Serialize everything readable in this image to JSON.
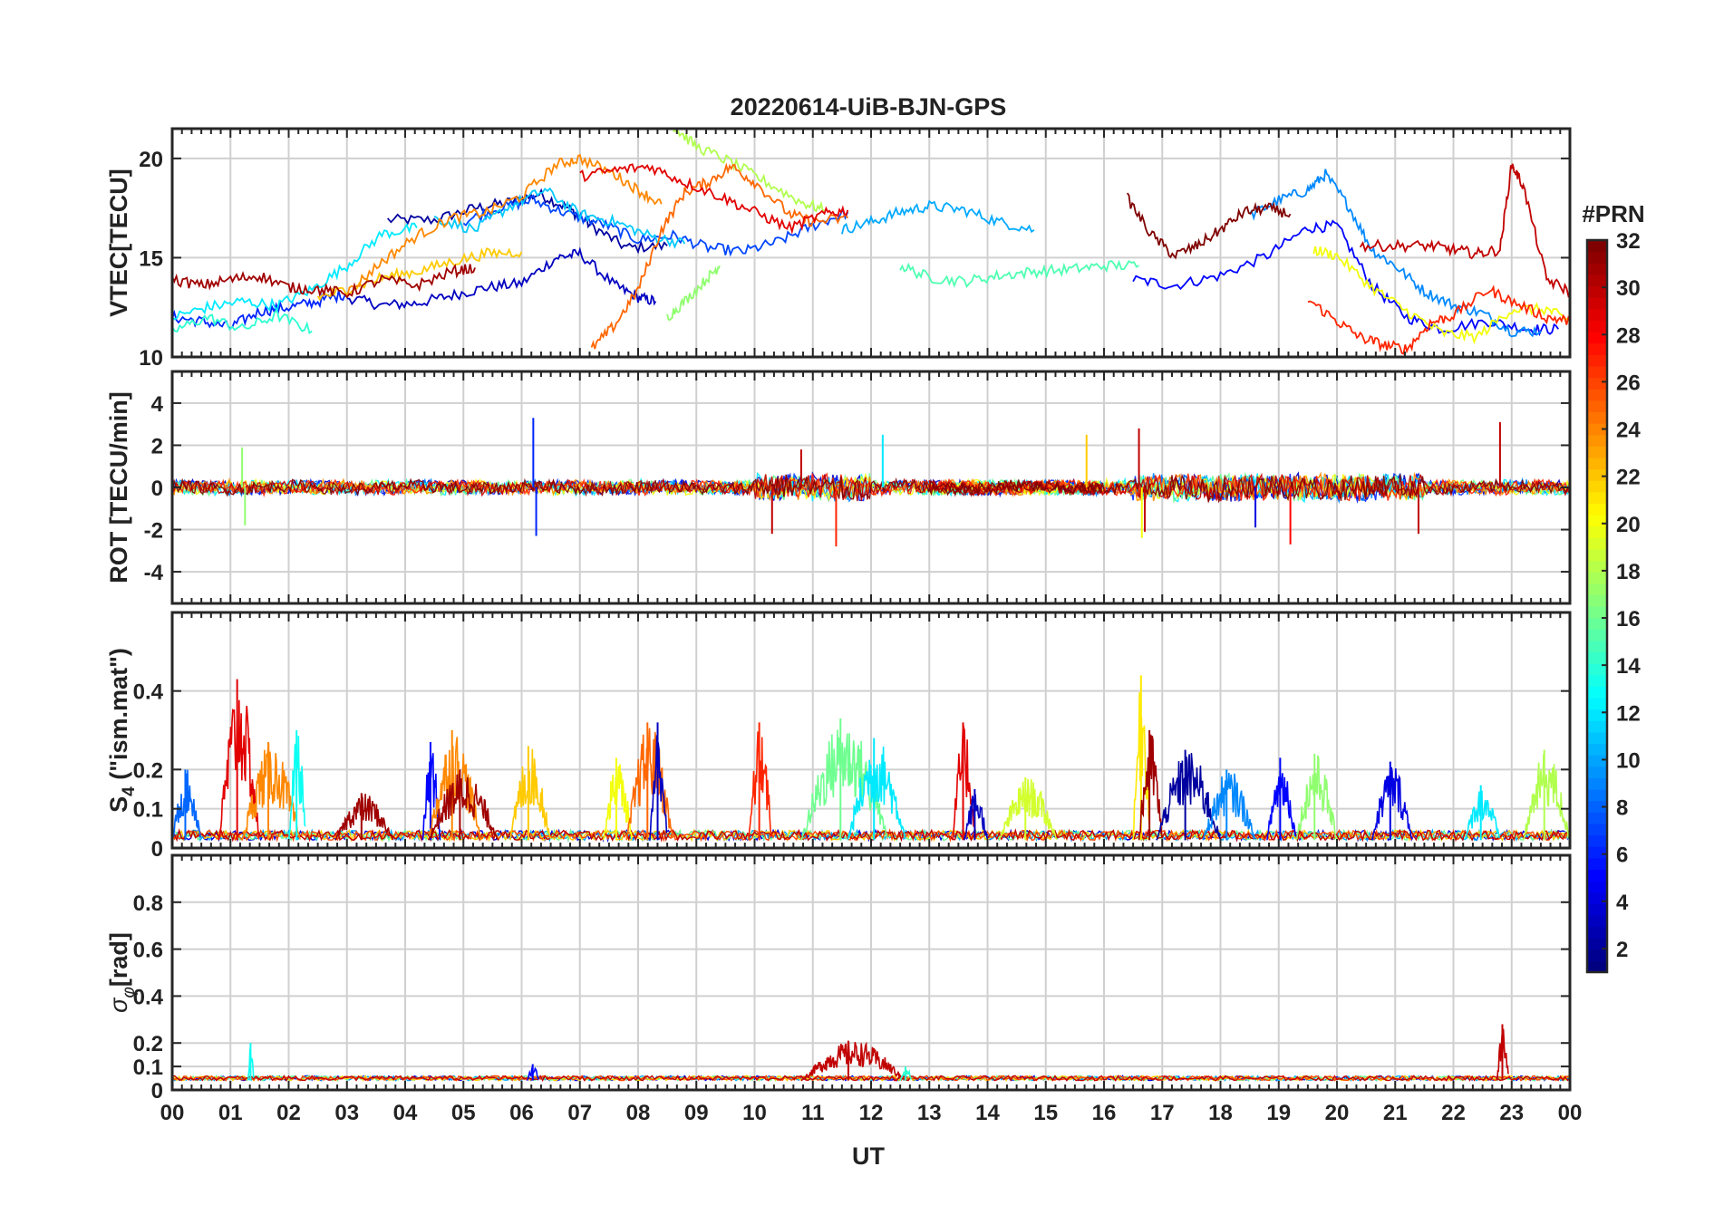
{
  "chart_data": {
    "type": "line",
    "title": "20220614-UiB-BJN-GPS",
    "xlabel": "UT",
    "x_range_hours": [
      0,
      24
    ],
    "x_tick_labels": [
      "00",
      "01",
      "02",
      "03",
      "04",
      "05",
      "06",
      "07",
      "08",
      "09",
      "10",
      "11",
      "12",
      "13",
      "14",
      "15",
      "16",
      "17",
      "18",
      "19",
      "20",
      "21",
      "22",
      "23",
      "00"
    ],
    "grid": true,
    "colormap": "jet",
    "colorbar": {
      "label": "#PRN",
      "range": [
        1,
        32
      ],
      "tick_values": [
        2,
        4,
        6,
        8,
        10,
        12,
        14,
        16,
        18,
        20,
        22,
        24,
        26,
        28,
        30,
        32
      ],
      "tick_labels": [
        "2",
        "4",
        "6",
        "8",
        "10",
        "12",
        "14",
        "16",
        "18",
        "20",
        "22",
        "24",
        "26",
        "28",
        "30",
        "32"
      ],
      "placement": "right"
    },
    "panels": [
      {
        "id": "vtec",
        "ylabel": "VTEC[TECU]",
        "ylim": [
          10,
          21.5
        ],
        "yticks": [
          10,
          15,
          20
        ],
        "ytick_labels": [
          "10",
          "15",
          "20"
        ],
        "series": [
          {
            "prn": 2,
            "x": [
              3.7,
              4.5,
              5.2,
              5.8,
              6.3,
              6.8,
              7.2,
              7.8,
              8.5
            ],
            "y": [
              16.9,
              16.9,
              17.5,
              17.8,
              18.2,
              17.5,
              16.6,
              15.5,
              15.6
            ]
          },
          {
            "prn": 3,
            "x": [
              3.0,
              3.6,
              4.2,
              4.8,
              5.4,
              6.0,
              6.6,
              7.0,
              7.6,
              8.0,
              8.3
            ],
            "y": [
              13.0,
              12.6,
              12.7,
              13.1,
              13.5,
              13.7,
              15.0,
              15.2,
              13.6,
              13.0,
              12.8
            ]
          },
          {
            "prn": 5,
            "x": [
              16.5,
              17.2,
              18.0,
              18.8,
              19.5,
              20.0,
              20.6,
              21.2,
              21.8,
              22.6,
              23.3,
              23.8
            ],
            "y": [
              13.9,
              13.6,
              14.1,
              15.1,
              16.5,
              16.6,
              13.6,
              12.0,
              11.4,
              11.8,
              11.4,
              11.4
            ]
          },
          {
            "prn": 6,
            "x": [
              0,
              0.5,
              1.0,
              1.5,
              2.0,
              2.5,
              3.0
            ],
            "y": [
              12.0,
              11.8,
              11.5,
              12.3,
              12.5,
              12.8,
              13.2
            ]
          },
          {
            "prn": 7,
            "x": [
              5.0,
              5.6,
              6.2,
              6.8,
              7.4,
              8.0,
              8.6,
              9.2,
              9.8,
              10.4,
              11.0,
              11.6
            ],
            "y": [
              16.8,
              17.5,
              17.9,
              17.2,
              16.7,
              15.9,
              16.1,
              15.5,
              15.3,
              15.8,
              16.6,
              17.3
            ]
          },
          {
            "prn": 9,
            "x": [
              18.5,
              19.0,
              19.5,
              19.8,
              20.2,
              20.6,
              21.0,
              21.5,
              22.0,
              22.5,
              23.0,
              23.5
            ],
            "y": [
              17.1,
              17.9,
              18.4,
              19.2,
              17.6,
              15.4,
              14.6,
              13.3,
              12.6,
              12.2,
              11.3,
              11.3
            ]
          },
          {
            "prn": 10,
            "x": [
              11.5,
              12.0,
              12.5,
              13.0,
              13.6,
              14.2,
              14.8
            ],
            "y": [
              16.4,
              16.8,
              17.3,
              17.6,
              17.4,
              16.8,
              16.4
            ]
          },
          {
            "prn": 11,
            "x": [
              4.5,
              5.2,
              5.8,
              6.4,
              7.0,
              7.6,
              8.2,
              8.8
            ],
            "y": [
              17.0,
              16.4,
              17.6,
              18.4,
              17.2,
              16.8,
              16.1,
              15.7
            ]
          },
          {
            "prn": 12,
            "x": [
              0,
              0.6,
              1.2,
              1.8,
              2.4,
              3.0,
              3.6,
              4.2
            ],
            "y": [
              12.0,
              12.5,
              12.8,
              12.6,
              13.4,
              14.6,
              16.2,
              16.5
            ]
          },
          {
            "prn": 14,
            "x": [
              0,
              0.6,
              1.2,
              1.8,
              2.4
            ],
            "y": [
              11.3,
              12.0,
              11.4,
              12.1,
              11.3
            ]
          },
          {
            "prn": 15,
            "x": [
              12.5,
              13.0,
              13.6,
              14.2,
              14.8,
              15.4,
              16.0,
              16.6
            ],
            "y": [
              14.6,
              14.0,
              13.8,
              14.1,
              14.3,
              14.4,
              14.6,
              14.6
            ]
          },
          {
            "prn": 17,
            "x": [
              8.5,
              8.8,
              9.2,
              9.4
            ],
            "y": [
              12.0,
              12.8,
              14.0,
              14.6
            ]
          },
          {
            "prn": 18,
            "x": [
              8.6,
              9.0,
              9.6,
              10.2,
              10.8,
              11.2
            ],
            "y": [
              21.6,
              20.6,
              19.8,
              18.8,
              17.8,
              17.4
            ]
          },
          {
            "prn": 20,
            "x": [
              19.6,
              20.0,
              20.6,
              21.2,
              21.8,
              22.4,
              23.0,
              23.6,
              24.0
            ],
            "y": [
              15.4,
              15.1,
              13.5,
              12.3,
              11.2,
              11.0,
              12.4,
              12.4,
              11.8
            ]
          },
          {
            "prn": 22,
            "x": [
              2.5,
              3.0,
              3.6,
              4.2,
              4.8,
              5.4,
              6.0
            ],
            "y": [
              13.0,
              13.4,
              14.0,
              14.3,
              14.8,
              15.2,
              15.3
            ]
          },
          {
            "prn": 24,
            "x": [
              3.0,
              3.6,
              4.2,
              4.8,
              5.4,
              6.0,
              6.6,
              7.0,
              7.6,
              8.0,
              8.4
            ],
            "y": [
              13.2,
              14.8,
              16.1,
              17.0,
              17.3,
              18.1,
              19.7,
              20.0,
              19.2,
              18.4,
              17.7
            ]
          },
          {
            "prn": 25,
            "x": [
              7.2,
              7.6,
              8.0,
              8.4,
              8.8,
              9.2,
              9.6,
              10.0,
              10.6,
              11.0,
              11.6
            ],
            "y": [
              10.4,
              11.6,
              13.4,
              16.4,
              18.3,
              18.8,
              19.6,
              18.8,
              17.2,
              16.8,
              17.0
            ]
          },
          {
            "prn": 27,
            "x": [
              19.5,
              20.0,
              20.4,
              20.8,
              21.2,
              21.6,
              22.0,
              22.6,
              23.0,
              23.6,
              24.0
            ],
            "y": [
              12.9,
              11.8,
              11.0,
              10.6,
              10.4,
              11.7,
              12.1,
              13.4,
              12.8,
              12.0,
              11.8
            ]
          },
          {
            "prn": 29,
            "x": [
              7.0,
              7.6,
              8.2,
              8.8,
              9.4,
              10.0,
              10.6,
              11.2,
              11.6
            ],
            "y": [
              19.1,
              19.4,
              19.6,
              18.8,
              18.1,
              17.3,
              16.5,
              17.2,
              17.4
            ]
          },
          {
            "prn": 30,
            "x": [
              20.4,
              21.0,
              21.6,
              22.0,
              22.4,
              22.8,
              23.0,
              23.2,
              23.6,
              24.0
            ],
            "y": [
              15.6,
              15.6,
              15.6,
              15.4,
              15.2,
              15.4,
              19.7,
              18.6,
              13.9,
              13.3
            ]
          },
          {
            "prn": 31,
            "x": [
              0,
              0.5,
              1.0,
              1.5,
              2.0,
              2.5,
              3.0,
              3.6,
              4.2,
              4.8,
              5.2
            ],
            "y": [
              13.9,
              13.6,
              13.9,
              14.1,
              13.5,
              13.4,
              13.2,
              13.9,
              13.6,
              14.3,
              14.5
            ]
          },
          {
            "prn": 32,
            "x": [
              16.4,
              16.8,
              17.2,
              17.6,
              18.0,
              18.4,
              18.8,
              19.2
            ],
            "y": [
              18.0,
              16.2,
              15.1,
              15.6,
              16.4,
              17.3,
              17.5,
              17.2
            ]
          }
        ]
      },
      {
        "id": "rot",
        "ylabel": "ROT [TECU/min]",
        "ylim": [
          -5.5,
          5.5
        ],
        "yticks": [
          -4,
          -2,
          0,
          2,
          4
        ],
        "ytick_labels": [
          "-4",
          "-2",
          "0",
          "2",
          "4"
        ],
        "noise_band": 0.25,
        "events": [
          {
            "prn": 6,
            "x": 6.2,
            "y": 3.3
          },
          {
            "prn": 6,
            "x": 6.25,
            "y": -2.3
          },
          {
            "prn": 27,
            "x": 11.4,
            "y": -2.8
          },
          {
            "prn": 30,
            "x": 10.8,
            "y": 1.8
          },
          {
            "prn": 30,
            "x": 10.3,
            "y": -2.2
          },
          {
            "prn": 12,
            "x": 12.2,
            "y": 2.5
          },
          {
            "prn": 22,
            "x": 15.7,
            "y": 2.5
          },
          {
            "prn": 30,
            "x": 16.6,
            "y": 2.8
          },
          {
            "prn": 30,
            "x": 16.7,
            "y": -2.1
          },
          {
            "prn": 20,
            "x": 16.65,
            "y": -2.4
          },
          {
            "prn": 28,
            "x": 19.2,
            "y": -2.7
          },
          {
            "prn": 30,
            "x": 21.4,
            "y": -2.2
          },
          {
            "prn": 30,
            "x": 22.8,
            "y": 3.1
          },
          {
            "prn": 17,
            "x": 1.2,
            "y": 1.9
          },
          {
            "prn": 17,
            "x": 1.25,
            "y": -1.8
          },
          {
            "prn": 4,
            "x": 18.6,
            "y": -1.9
          }
        ]
      },
      {
        "id": "s4",
        "ylabel": "S4 (\"ism.mat\")",
        "ylabel_main": "S",
        "ylabel_sub": "4",
        "ylabel_rest": " (\"ism.mat\")",
        "ylim": [
          0,
          0.6
        ],
        "yticks": [
          0,
          0.1,
          0.2,
          0.4
        ],
        "ytick_labels": [
          "0",
          "0.1",
          "0.2",
          "0.4"
        ],
        "bursts": [
          {
            "prn": 8,
            "x0": 0.0,
            "x1": 0.5,
            "peak": 0.2
          },
          {
            "prn": 29,
            "x0": 0.8,
            "x1": 1.5,
            "peak": 0.43
          },
          {
            "prn": 24,
            "x0": 1.2,
            "x1": 2.2,
            "peak": 0.27
          },
          {
            "prn": 13,
            "x0": 2.0,
            "x1": 2.3,
            "peak": 0.3
          },
          {
            "prn": 31,
            "x0": 2.8,
            "x1": 3.8,
            "peak": 0.14
          },
          {
            "prn": 5,
            "x0": 4.3,
            "x1": 4.6,
            "peak": 0.27
          },
          {
            "prn": 24,
            "x0": 4.4,
            "x1": 5.3,
            "peak": 0.3
          },
          {
            "prn": 31,
            "x0": 4.4,
            "x1": 5.6,
            "peak": 0.2
          },
          {
            "prn": 22,
            "x0": 5.8,
            "x1": 6.5,
            "peak": 0.26
          },
          {
            "prn": 20,
            "x0": 7.4,
            "x1": 7.9,
            "peak": 0.23
          },
          {
            "prn": 25,
            "x0": 7.8,
            "x1": 8.6,
            "peak": 0.32
          },
          {
            "prn": 3,
            "x0": 8.2,
            "x1": 8.5,
            "peak": 0.32
          },
          {
            "prn": 27,
            "x0": 9.9,
            "x1": 10.3,
            "peak": 0.32
          },
          {
            "prn": 16,
            "x0": 10.8,
            "x1": 12.3,
            "peak": 0.33
          },
          {
            "prn": 12,
            "x0": 11.6,
            "x1": 12.6,
            "peak": 0.28
          },
          {
            "prn": 29,
            "x0": 13.4,
            "x1": 13.8,
            "peak": 0.32
          },
          {
            "prn": 3,
            "x0": 13.6,
            "x1": 14.0,
            "peak": 0.15
          },
          {
            "prn": 19,
            "x0": 14.2,
            "x1": 15.2,
            "peak": 0.18
          },
          {
            "prn": 21,
            "x0": 16.5,
            "x1": 16.8,
            "peak": 0.44
          },
          {
            "prn": 31,
            "x0": 16.6,
            "x1": 17.0,
            "peak": 0.3
          },
          {
            "prn": 2,
            "x0": 16.9,
            "x1": 18.0,
            "peak": 0.25
          },
          {
            "prn": 9,
            "x0": 17.7,
            "x1": 18.6,
            "peak": 0.2
          },
          {
            "prn": 5,
            "x0": 18.8,
            "x1": 19.3,
            "peak": 0.23
          },
          {
            "prn": 17,
            "x0": 19.3,
            "x1": 20.0,
            "peak": 0.24
          },
          {
            "prn": 4,
            "x0": 20.6,
            "x1": 21.3,
            "peak": 0.22
          },
          {
            "prn": 12,
            "x0": 22.2,
            "x1": 22.8,
            "peak": 0.16
          },
          {
            "prn": 18,
            "x0": 23.2,
            "x1": 24.0,
            "peak": 0.25
          }
        ]
      },
      {
        "id": "sigma_phi",
        "ylabel": "σφ[rad]",
        "ylabel_main": "σ",
        "ylabel_sub": "φ",
        "ylabel_rest": "[rad]",
        "ylim": [
          0,
          1.0
        ],
        "yticks": [
          0,
          0.1,
          0.2,
          0.4,
          0.6,
          0.8
        ],
        "ytick_labels": [
          "0",
          "0.1",
          "0.2",
          "0.4",
          "0.6",
          "0.8"
        ],
        "baseline": 0.04,
        "bursts": [
          {
            "prn": 30,
            "x0": 10.8,
            "x1": 12.6,
            "peak": 0.21
          },
          {
            "prn": 13,
            "x0": 1.3,
            "x1": 1.4,
            "peak": 0.2
          },
          {
            "prn": 30,
            "x0": 22.75,
            "x1": 22.95,
            "peak": 0.28
          },
          {
            "prn": 5,
            "x0": 6.1,
            "x1": 6.3,
            "peak": 0.11
          },
          {
            "prn": 14,
            "x0": 12.5,
            "x1": 12.7,
            "peak": 0.1
          }
        ]
      }
    ]
  }
}
